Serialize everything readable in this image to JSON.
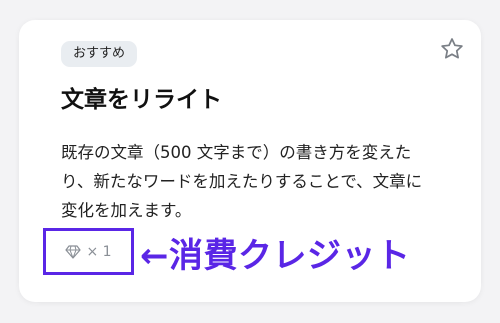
{
  "card": {
    "badge": "おすすめ",
    "title": "文章をリライト",
    "description": "既存の文章（500 文字まで）の書き方を変えたり、新たなワードを加えたりすることで、文章に変化を加えます。",
    "favorite_icon": "star-outline-icon",
    "credit": {
      "icon": "diamond-icon",
      "value": "× 1"
    }
  },
  "annotation": {
    "text": "←消費クレジット",
    "color": "#5a26e6"
  }
}
